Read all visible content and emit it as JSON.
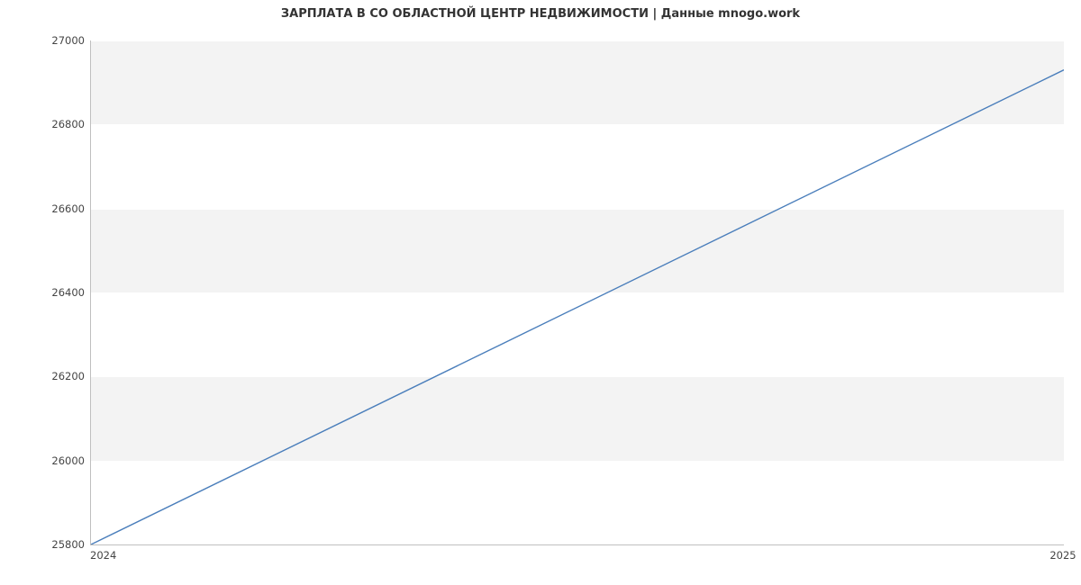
{
  "chart_data": {
    "type": "line",
    "title": "ЗАРПЛАТА В СО ОБЛАСТНОЙ ЦЕНТР НЕДВИЖИМОСТИ | Данные mnogo.work",
    "xlabel": "",
    "ylabel": "",
    "x": [
      "2024",
      "2025"
    ],
    "values": [
      25800,
      26930
    ],
    "xlim": [
      "2024",
      "2025"
    ],
    "ylim": [
      25800,
      27000
    ],
    "y_ticks": [
      25800,
      26000,
      26200,
      26400,
      26600,
      26800,
      27000
    ],
    "x_ticks": [
      "2024",
      "2025"
    ],
    "grid": true,
    "line_color": "#4a7ebb"
  }
}
